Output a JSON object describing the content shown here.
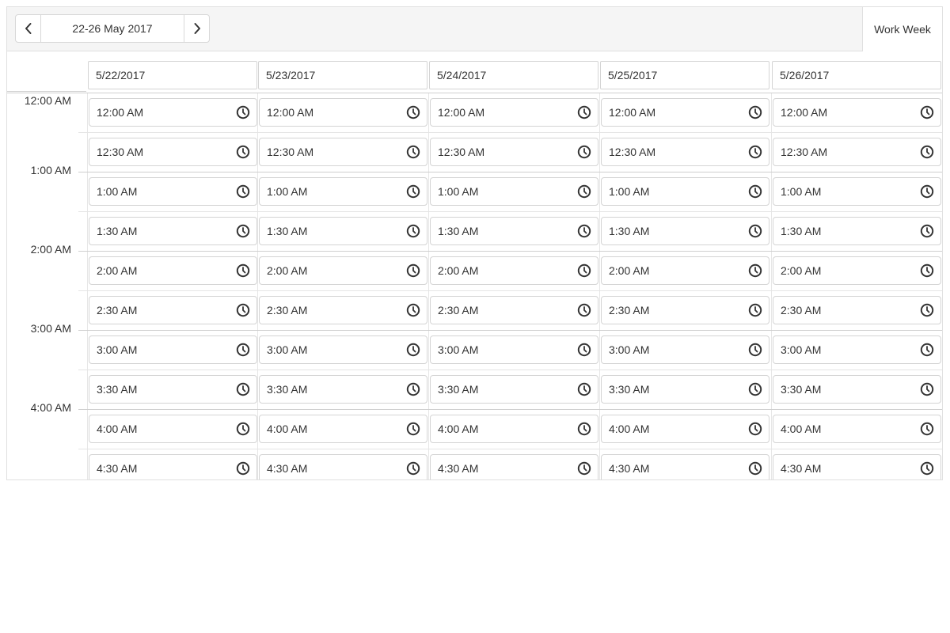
{
  "toolbar": {
    "prev_icon": "chevron-left-icon",
    "next_icon": "chevron-right-icon",
    "date_range": "22-26 May 2017",
    "view_label": "Work Week"
  },
  "columns": [
    "5/22/2017",
    "5/23/2017",
    "5/24/2017",
    "5/25/2017",
    "5/26/2017"
  ],
  "hours": [
    "12:00 AM",
    "1:00 AM",
    "2:00 AM",
    "3:00 AM",
    "4:00 AM"
  ],
  "slots": [
    "12:00 AM",
    "12:30 AM",
    "1:00 AM",
    "1:30 AM",
    "2:00 AM",
    "2:30 AM",
    "3:00 AM",
    "3:30 AM",
    "4:00 AM",
    "4:30 AM"
  ],
  "slot_icon": "clock-icon"
}
